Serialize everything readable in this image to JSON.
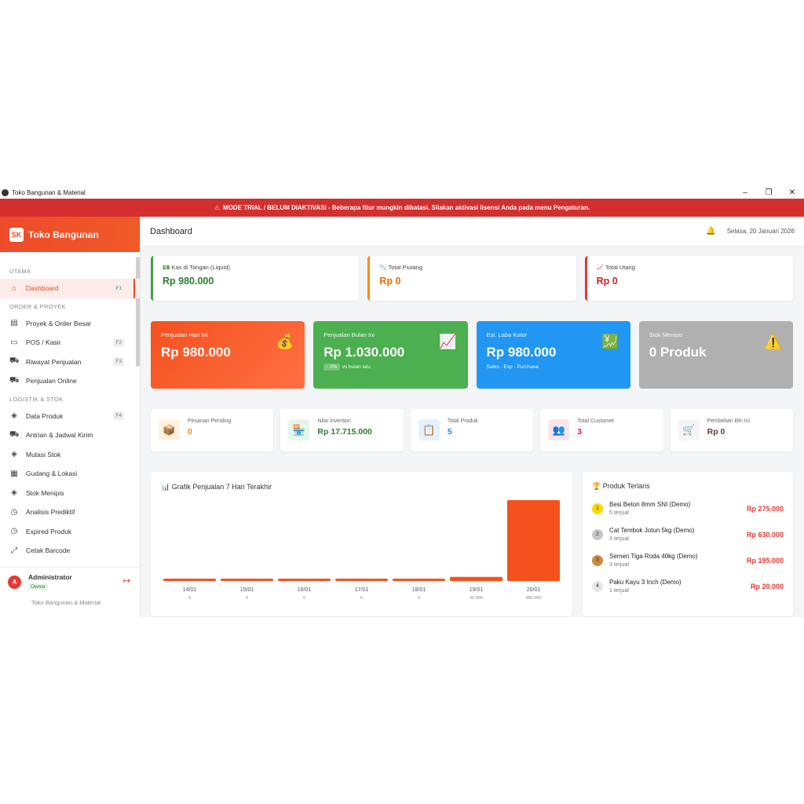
{
  "window": {
    "title": "Toko Bangunan & Material",
    "controls": [
      "–",
      "❐",
      "✕"
    ]
  },
  "banner": {
    "icon": "⚠",
    "text": "MODE TRIAL / BELUM DIAKTIVASI - Beberapa fitur mungkin dibatasi. Silakan aktivasi lisensi Anda pada menu Pengaturan."
  },
  "brand": {
    "logo": "SK",
    "name": "Toko Bangunan"
  },
  "sidebar": {
    "sections": [
      {
        "title": "UTAMA",
        "items": [
          {
            "label": "Dashboard",
            "key": "F1",
            "icon": "⌂",
            "active": true
          }
        ]
      },
      {
        "title": "ORDER & PROYEK",
        "items": [
          {
            "label": "Proyek & Order Besar",
            "key": "",
            "icon": "▤"
          },
          {
            "label": "POS / Kasir",
            "key": "F2",
            "icon": "▭"
          },
          {
            "label": "Riwayat Penjualan",
            "key": "F3",
            "icon": "⛟"
          },
          {
            "label": "Penjualan Online",
            "key": "",
            "icon": "⛟"
          }
        ]
      },
      {
        "title": "LOGISTIK & STOK",
        "items": [
          {
            "label": "Data Produk",
            "key": "F4",
            "icon": "◈"
          },
          {
            "label": "Antrian & Jadwal Kirim",
            "key": "",
            "icon": "⛟"
          },
          {
            "label": "Mutasi Stok",
            "key": "",
            "icon": "◈"
          },
          {
            "label": "Gudang & Lokasi",
            "key": "",
            "icon": "▦"
          },
          {
            "label": "Stok Menipis",
            "key": "",
            "icon": "◈"
          },
          {
            "label": "Analisis Prediktif",
            "key": "",
            "icon": "◷"
          },
          {
            "label": "Expired Produk",
            "key": "",
            "icon": "◷"
          },
          {
            "label": "Cetak Barcode",
            "key": "",
            "icon": "⤢"
          }
        ]
      }
    ]
  },
  "user": {
    "initial": "A",
    "name": "Administrator",
    "role": "Owner",
    "store": "Toko Bangunan & Material",
    "logout_icon": "↦"
  },
  "header": {
    "title": "Dashboard",
    "bell_icon": "🔔",
    "date": "Selasa, 20 Januari 2026"
  },
  "finance": [
    {
      "icon": "💵",
      "label": "Kas di Tangan (Liquid)",
      "value": "Rp 980.000",
      "color": "#2e7d32",
      "border": "#43a047"
    },
    {
      "icon": "📉",
      "label": "Total Piutang",
      "value": "Rp 0",
      "color": "#ef6c00",
      "border": "#fb8c00"
    },
    {
      "icon": "📈",
      "label": "Total Utang",
      "value": "Rp 0",
      "color": "#c62828",
      "border": "#e53935"
    }
  ],
  "stats": [
    {
      "label": "Penjualan Hari Ini",
      "value": "Rp 980.000",
      "icon": "💰",
      "bg": "linear-gradient(135deg,#f4511e,#ff7043)",
      "sub_pill": "",
      "sub": ""
    },
    {
      "label": "Penjualan Bulan Ini",
      "value": "Rp 1.030.000",
      "icon": "📈",
      "bg": "#4caf50",
      "sub_pill": "↑ 0%",
      "sub": "vs bulan lalu"
    },
    {
      "label": "Est. Laba Kotor",
      "value": "Rp 980.000",
      "icon": "💹",
      "bg": "#2196f3",
      "sub_pill": "",
      "sub": "Sales - Exp - Purchase"
    },
    {
      "label": "Stok Menipis",
      "value": "0 Produk",
      "icon": "⚠️",
      "bg": "#b0b0b0",
      "sub_pill": "",
      "sub": ""
    }
  ],
  "mini": [
    {
      "label": "Pesanan Pending",
      "value": "0",
      "icon": "📦",
      "icon_bg": "#fff3e0",
      "color": "#fb8c00"
    },
    {
      "label": "Nilai Inventori",
      "value": "Rp 17.715.000",
      "icon": "🏪",
      "icon_bg": "#e8f5e9",
      "color": "#2e7d32"
    },
    {
      "label": "Total Produk",
      "value": "5",
      "icon": "📋",
      "icon_bg": "#e3f2fd",
      "color": "#1e88e5"
    },
    {
      "label": "Total Customer",
      "value": "3",
      "icon": "👥",
      "icon_bg": "#fce4ec",
      "color": "#d81b60"
    },
    {
      "label": "Pembelian Bln Ini",
      "value": "Rp 0",
      "icon": "🛒",
      "icon_bg": "#f5f5f5",
      "color": "#5d4037"
    }
  ],
  "chart_card": {
    "icon": "📊",
    "title": "Grafik Penjualan 7 Hari Terakhir"
  },
  "chart_data": {
    "type": "bar",
    "categories": [
      "14/01",
      "15/01",
      "16/01",
      "17/01",
      "18/01",
      "19/01",
      "20/01"
    ],
    "values": [
      0,
      0,
      0,
      0,
      0,
      50000,
      980000
    ],
    "value_labels": [
      "0",
      "0",
      "0",
      "0",
      "0",
      "50.000",
      "980.000"
    ],
    "ylim": [
      0,
      980000
    ],
    "color": "#f4511e",
    "grid": false
  },
  "top_products": {
    "icon": "🏆",
    "title": "Produk Terlaris",
    "items": [
      {
        "rank": "1",
        "name": "Besi Beton 8mm SNI (Demo)",
        "sold": "5 terjual",
        "price": "Rp 275.000",
        "rank_bg": "#ffd600"
      },
      {
        "rank": "2",
        "name": "Cat Tembok Jotun 5kg (Demo)",
        "sold": "3 terjual",
        "price": "Rp 630.000",
        "rank_bg": "#c7c7c7"
      },
      {
        "rank": "3",
        "name": "Semen Tiga Roda 40kg (Demo)",
        "sold": "3 terjual",
        "price": "Rp 195.000",
        "rank_bg": "#cd8a3f"
      },
      {
        "rank": "4",
        "name": "Paku Kayu 3 Inch (Demo)",
        "sold": "1 terjual",
        "price": "Rp 20.000",
        "rank_bg": "#e6e6e6"
      }
    ]
  }
}
